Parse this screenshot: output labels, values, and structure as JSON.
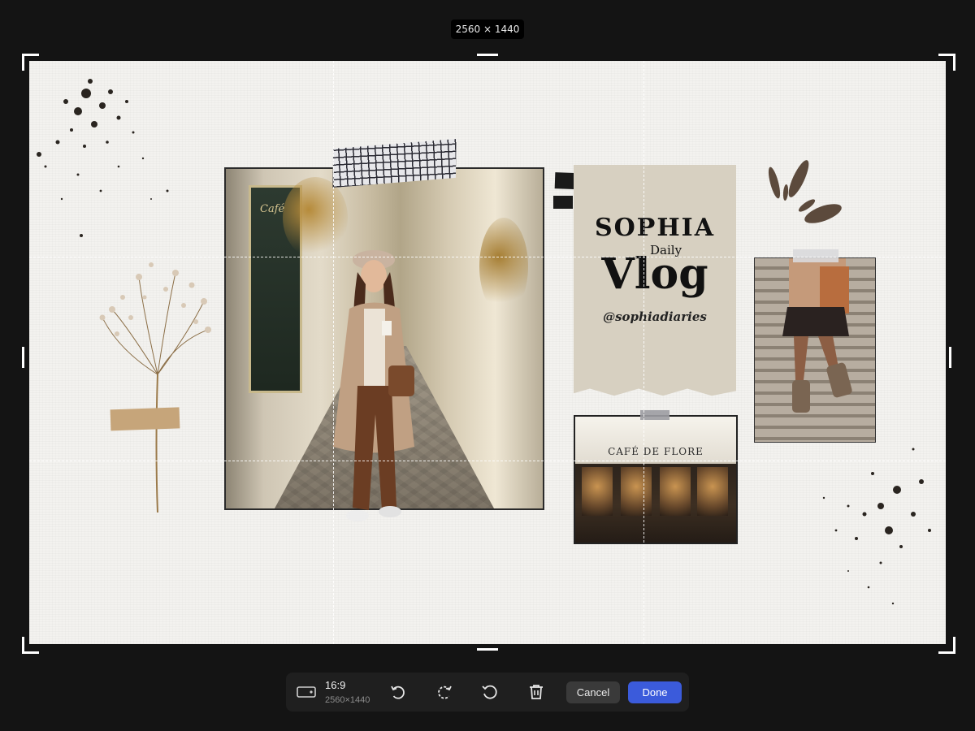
{
  "dimensions_badge": "2560 × 1440",
  "canvas": {
    "title_card": {
      "name": "SOPHIA",
      "small": "Daily",
      "big": "Vlog",
      "handle": "@sophiadiaries"
    },
    "cafe_sign": "CAFÉ DE FLORE",
    "shop_sign": "Café"
  },
  "toolbar": {
    "ratio_label": "16:9",
    "ratio_size": "2560×1440",
    "cancel_label": "Cancel",
    "done_label": "Done"
  },
  "colors": {
    "background": "#141414",
    "paper": "#f3f2ef",
    "accent": "#3b5bdb",
    "title_card": "#d7d0c1"
  },
  "icons": [
    "aspect-ratio-icon",
    "rotate-left-icon",
    "rotate-right-icon",
    "reset-icon",
    "trash-icon"
  ]
}
